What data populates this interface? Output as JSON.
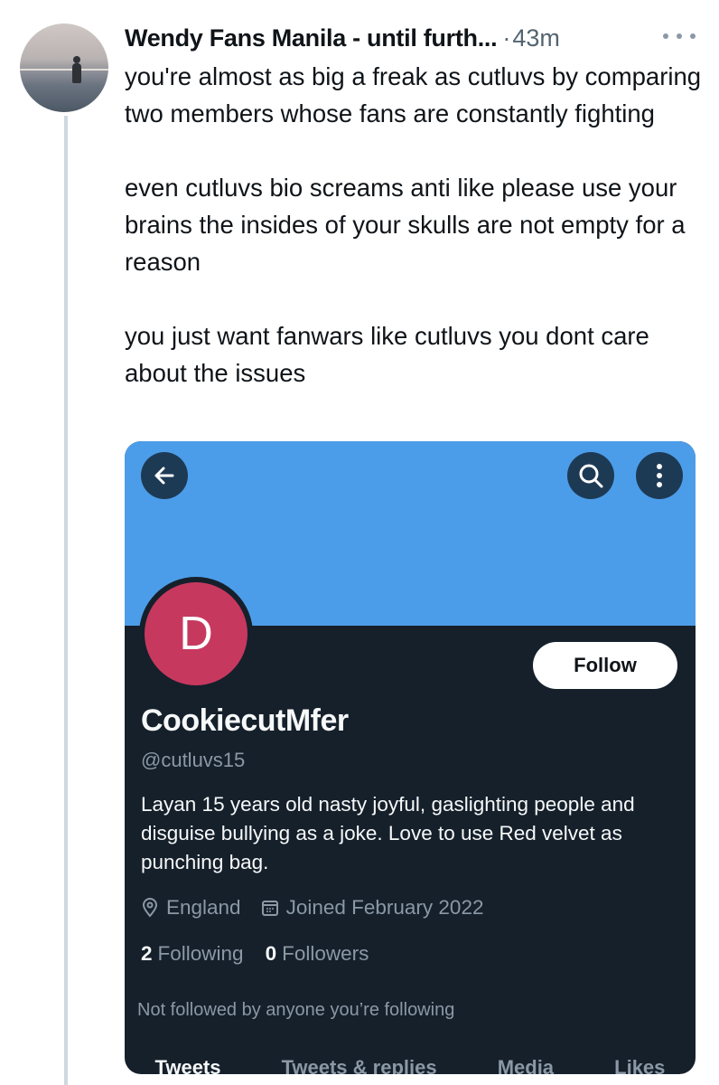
{
  "post": {
    "author_name": "Wendy Fans Manila - until furth...",
    "separator": "·",
    "time": "43m",
    "text": "you're almost as big a freak as cutluvs by comparing two members whose fans are constantly fighting\n\neven cutluvs bio screams anti like please use your brains the insides of your skulls are not empty for a reason\n\nyou just want fanwars like cutluvs you dont care about the issues"
  },
  "profile_card": {
    "avatar_letter": "D",
    "follow_label": "Follow",
    "display_name": "CookiecutMfer",
    "handle": "@cutluvs15",
    "bio": "Layan 15 years old nasty joyful, gaslighting people and disguise bullying as a joke. Love to use Red velvet as punching bag.",
    "location": "England",
    "joined": "Joined February 2022",
    "following_count": "2",
    "following_label": "Following",
    "followers_count": "0",
    "followers_label": "Followers",
    "not_followed_text": "Not followed by anyone you’re following",
    "tabs": [
      "Tweets",
      "Tweets & replies",
      "Media",
      "Likes"
    ],
    "colors": {
      "banner": "#4c9de9",
      "background": "#15202b",
      "avatar": "#c7385f"
    }
  },
  "icons": [
    "back-arrow-icon",
    "search-icon",
    "more-vertical-icon",
    "more-horizontal-icon",
    "location-pin-icon",
    "calendar-icon"
  ]
}
